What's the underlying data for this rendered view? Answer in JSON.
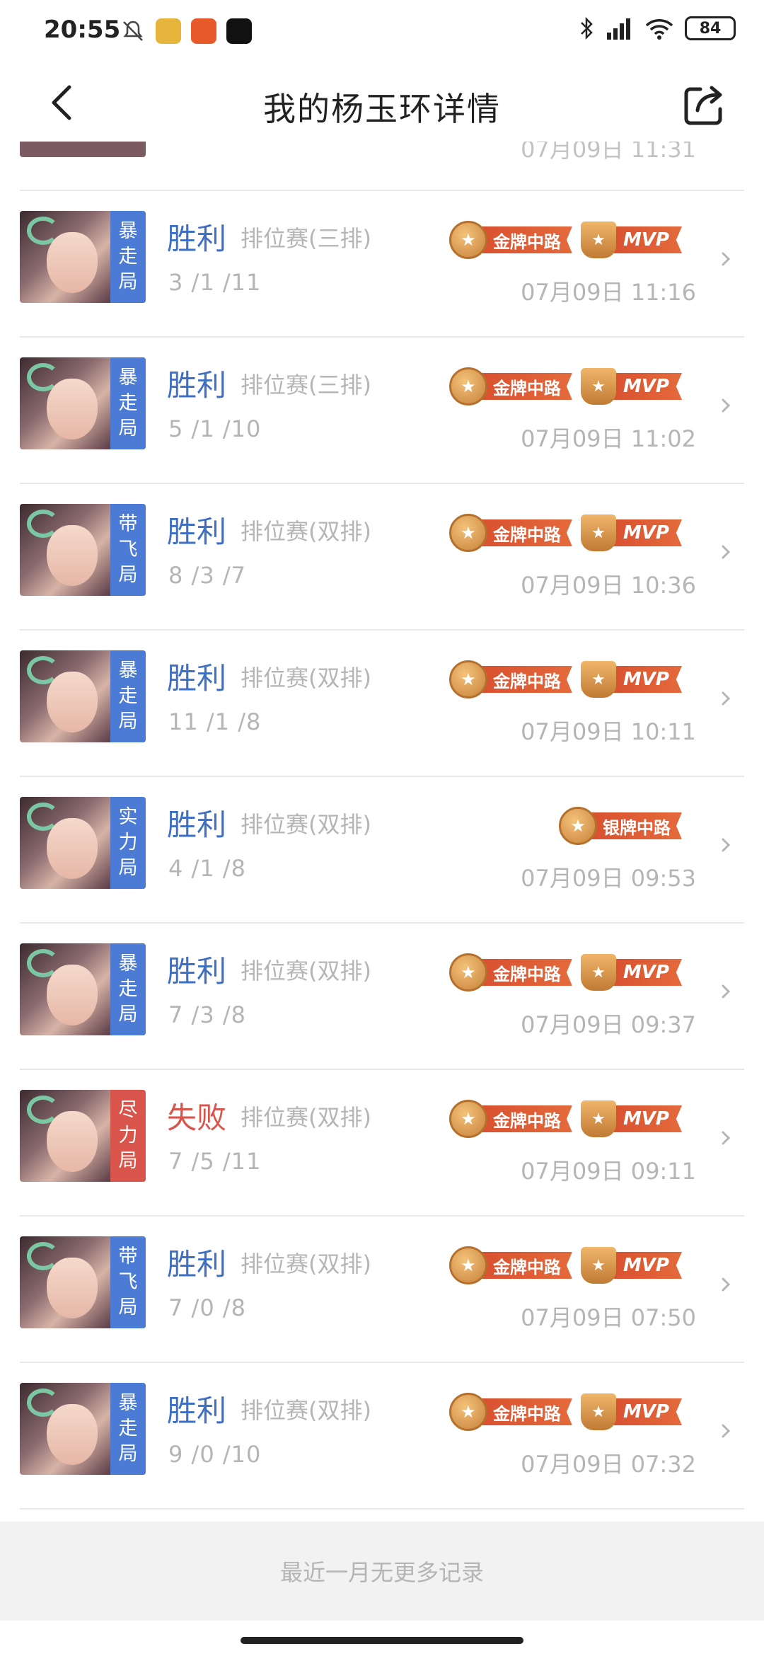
{
  "status_bar": {
    "time": "20:55",
    "battery": "84"
  },
  "header": {
    "title": "我的杨玉环详情"
  },
  "partial_row": {
    "date": "07月09日 11:31"
  },
  "matches": [
    {
      "tag_line1": "暴",
      "tag_line2": "走",
      "tag_line3": "局",
      "tag_color": "blue",
      "result": "胜利",
      "mode": "排位赛(三排)",
      "kda": "3 /1 /11",
      "date": "07月09日 11:16",
      "medal": "金牌中路",
      "mvp": "MVP"
    },
    {
      "tag_line1": "暴",
      "tag_line2": "走",
      "tag_line3": "局",
      "tag_color": "blue",
      "result": "胜利",
      "mode": "排位赛(三排)",
      "kda": "5 /1 /10",
      "date": "07月09日 11:02",
      "medal": "金牌中路",
      "mvp": "MVP"
    },
    {
      "tag_line1": "带",
      "tag_line2": "飞",
      "tag_line3": "局",
      "tag_color": "blue",
      "result": "胜利",
      "mode": "排位赛(双排)",
      "kda": "8 /3 /7",
      "date": "07月09日 10:36",
      "medal": "金牌中路",
      "mvp": "MVP"
    },
    {
      "tag_line1": "暴",
      "tag_line2": "走",
      "tag_line3": "局",
      "tag_color": "blue",
      "result": "胜利",
      "mode": "排位赛(双排)",
      "kda": "11 /1 /8",
      "date": "07月09日 10:11",
      "medal": "金牌中路",
      "mvp": "MVP"
    },
    {
      "tag_line1": "实",
      "tag_line2": "力",
      "tag_line3": "局",
      "tag_color": "blue",
      "result": "胜利",
      "mode": "排位赛(双排)",
      "kda": "4 /1 /8",
      "date": "07月09日 09:53",
      "medal": "银牌中路",
      "mvp": ""
    },
    {
      "tag_line1": "暴",
      "tag_line2": "走",
      "tag_line3": "局",
      "tag_color": "blue",
      "result": "胜利",
      "mode": "排位赛(双排)",
      "kda": "7 /3 /8",
      "date": "07月09日 09:37",
      "medal": "金牌中路",
      "mvp": "MVP"
    },
    {
      "tag_line1": "尽",
      "tag_line2": "力",
      "tag_line3": "局",
      "tag_color": "red",
      "result": "失败",
      "mode": "排位赛(双排)",
      "kda": "7 /5 /11",
      "date": "07月09日 09:11",
      "medal": "金牌中路",
      "mvp": "MVP"
    },
    {
      "tag_line1": "带",
      "tag_line2": "飞",
      "tag_line3": "局",
      "tag_color": "blue",
      "result": "胜利",
      "mode": "排位赛(双排)",
      "kda": "7 /0 /8",
      "date": "07月09日 07:50",
      "medal": "金牌中路",
      "mvp": "MVP"
    },
    {
      "tag_line1": "暴",
      "tag_line2": "走",
      "tag_line3": "局",
      "tag_color": "blue",
      "result": "胜利",
      "mode": "排位赛(双排)",
      "kda": "9 /0 /10",
      "date": "07月09日 07:32",
      "medal": "金牌中路",
      "mvp": "MVP"
    }
  ],
  "footer": {
    "text": "最近一月无更多记录"
  },
  "colors": {
    "win": "#3d6fc4",
    "lose": "#d9544a",
    "tag_blue": "#4c7bd5",
    "tag_red": "#d9544a"
  }
}
